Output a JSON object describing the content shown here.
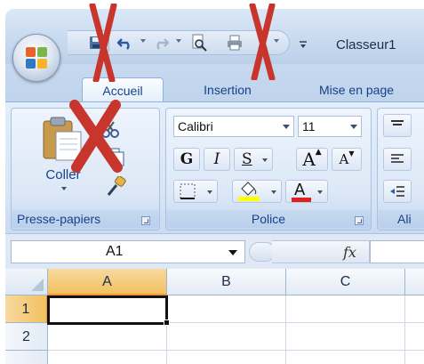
{
  "title_bar": {
    "document_title": "Classeur1",
    "quick_access": [
      {
        "name": "save-icon"
      },
      {
        "name": "undo-icon"
      },
      {
        "name": "redo-icon"
      },
      {
        "name": "print-preview-icon"
      },
      {
        "name": "print-icon"
      }
    ]
  },
  "tabs": [
    {
      "label": "Accueil",
      "active": true
    },
    {
      "label": "Insertion",
      "active": false
    },
    {
      "label": "Mise en page",
      "active": false
    }
  ],
  "ribbon": {
    "clipboard": {
      "paste_label": "Coller",
      "group_label": "Presse-papiers"
    },
    "font": {
      "font_name": "Calibri",
      "font_size": "11",
      "bold": "G",
      "italic": "I",
      "underline": "S",
      "grow": "A",
      "shrink": "A",
      "font_color_glyph": "A",
      "group_label": "Police"
    },
    "alignment": {
      "group_label": "Ali"
    }
  },
  "formula_bar": {
    "name_box": "A1",
    "fx": "fx",
    "formula": ""
  },
  "grid": {
    "columns": [
      "A",
      "B",
      "C"
    ],
    "rows": [
      "1",
      "2"
    ],
    "selected_column": "A",
    "selected_row": "1"
  },
  "colors": {
    "tab_text": "#15428b",
    "highlight_fill": "#ffff00",
    "font_color_bar": "#e0201c",
    "selection_header": "#f1c15f",
    "cross_mark": "#c8352c"
  }
}
